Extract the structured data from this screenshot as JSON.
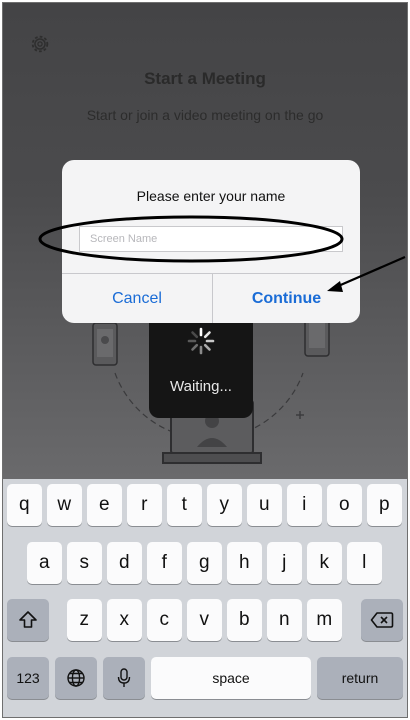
{
  "header": {
    "title": "Start a Meeting",
    "subtitle": "Start or join a video meeting on the go"
  },
  "waiting": {
    "text": "Waiting..."
  },
  "dialog": {
    "title": "Please enter your name",
    "input_placeholder": "Screen Name",
    "input_value": "",
    "cancel_label": "Cancel",
    "continue_label": "Continue",
    "accent_color": "#1a6cd6"
  },
  "keyboard": {
    "row1": [
      "q",
      "w",
      "e",
      "r",
      "t",
      "y",
      "u",
      "i",
      "o",
      "p"
    ],
    "row2": [
      "a",
      "s",
      "d",
      "f",
      "g",
      "h",
      "j",
      "k",
      "l"
    ],
    "row3": [
      "z",
      "x",
      "c",
      "v",
      "b",
      "n",
      "m"
    ],
    "numbers_label": "123",
    "space_label": "space",
    "return_label": "return",
    "icons": [
      "shift-icon",
      "backspace-icon",
      "globe-icon",
      "microphone-icon"
    ]
  },
  "icons": [
    "gear-icon",
    "spinner-icon"
  ]
}
